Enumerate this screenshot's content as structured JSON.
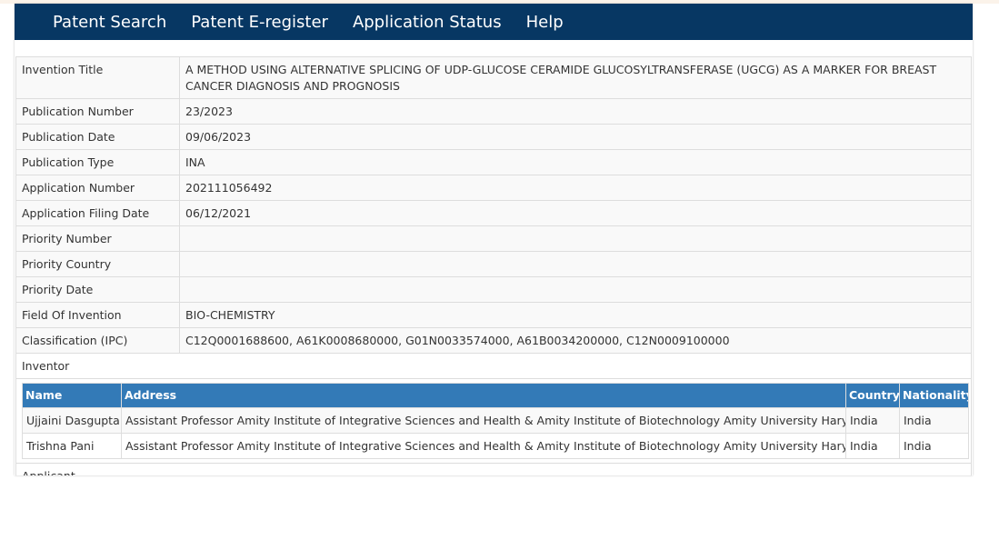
{
  "nav": {
    "items": [
      "Patent Search",
      "Patent E-register",
      "Application Status",
      "Help"
    ]
  },
  "details": [
    {
      "label": "Invention Title",
      "value": "A METHOD USING ALTERNATIVE SPLICING OF UDP-GLUCOSE CERAMIDE GLUCOSYLTRANSFERASE (UGCG) AS A MARKER FOR BREAST CANCER DIAGNOSIS AND PROGNOSIS"
    },
    {
      "label": "Publication Number",
      "value": "23/2023"
    },
    {
      "label": "Publication Date",
      "value": "09/06/2023"
    },
    {
      "label": "Publication Type",
      "value": "INA"
    },
    {
      "label": "Application Number",
      "value": "202111056492"
    },
    {
      "label": "Application Filing Date",
      "value": "06/12/2021"
    },
    {
      "label": "Priority Number",
      "value": ""
    },
    {
      "label": "Priority Country",
      "value": ""
    },
    {
      "label": "Priority Date",
      "value": ""
    },
    {
      "label": "Field Of Invention",
      "value": "BIO-CHEMISTRY"
    },
    {
      "label": "Classification (IPC)",
      "value": "C12Q0001688600, A61K0008680000, G01N0033574000, A61B0034200000, C12N0009100000"
    }
  ],
  "inventor": {
    "section_label": "Inventor",
    "headers": {
      "name": "Name",
      "address": "Address",
      "country": "Country",
      "nationality": "Nationality"
    },
    "rows": [
      {
        "name": "Ujjaini Dasgupta",
        "address": "Assistant Professor Amity Institute of Integrative Sciences and Health & Amity Institute of Biotechnology Amity University Haryana.",
        "country": "India",
        "nationality": "India"
      },
      {
        "name": "Trishna Pani",
        "address": "Assistant Professor Amity Institute of Integrative Sciences and Health & Amity Institute of Biotechnology Amity University Haryana",
        "country": "India",
        "nationality": "India"
      }
    ]
  },
  "applicant": {
    "section_label": "Applicant"
  },
  "colors": {
    "navbar": "#073763",
    "table_header": "#337ab7",
    "stripe": "#f9f9f9",
    "border": "#dddddd"
  }
}
